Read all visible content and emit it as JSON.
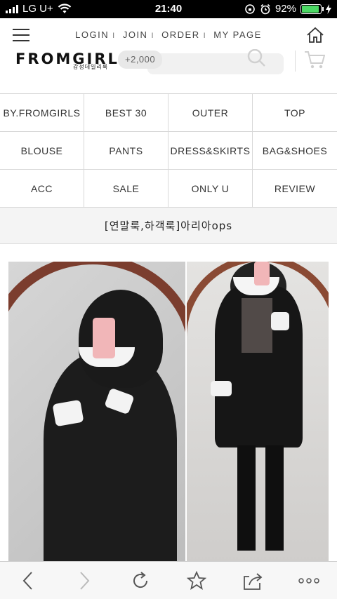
{
  "status_bar": {
    "carrier": "LG U+",
    "time": "21:40",
    "battery": "92%",
    "battery_level": 0.92
  },
  "header": {
    "links": [
      "LOGIN",
      "JOIN",
      "ORDER",
      "MY PAGE"
    ],
    "separator": "I"
  },
  "brand": {
    "logo": "FROMGIRLS",
    "tagline": "감성데일리룩",
    "points": "+2,000"
  },
  "categories": [
    [
      "BY.FROMGIRLS",
      "BEST 30",
      "OUTER",
      "TOP"
    ],
    [
      "BLOUSE",
      "PANTS",
      "DRESS&SKIRTS",
      "BAG&SHOES"
    ],
    [
      "ACC",
      "SALE",
      "ONLY U",
      "REVIEW"
    ]
  ],
  "product": {
    "title": "[연말룩,하객룩]아리아ops"
  },
  "toolbar": {
    "icons": [
      "back-icon",
      "forward-icon",
      "reload-icon",
      "bookmark-star-icon",
      "share-icon",
      "more-icon"
    ]
  }
}
